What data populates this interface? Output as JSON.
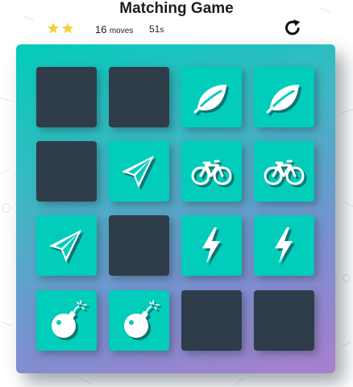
{
  "header": {
    "title": "Matching Game"
  },
  "score": {
    "stars_filled": 2,
    "star_icon": "star-icon",
    "star_color": "#f4d03f",
    "moves_count": "16",
    "moves_label": "moves",
    "timer_value": "51",
    "timer_unit": "s",
    "restart_icon": "restart-icon"
  },
  "deck": {
    "open_color": "#02ccba",
    "closed_color": "#2e3d49",
    "cards": [
      {
        "state": "closed",
        "icon": null
      },
      {
        "state": "closed",
        "icon": null
      },
      {
        "state": "open",
        "icon": "leaf-icon"
      },
      {
        "state": "open",
        "icon": "leaf-icon"
      },
      {
        "state": "closed",
        "icon": null
      },
      {
        "state": "open",
        "icon": "paper-plane-icon"
      },
      {
        "state": "open",
        "icon": "bicycle-icon"
      },
      {
        "state": "open",
        "icon": "bicycle-icon"
      },
      {
        "state": "open",
        "icon": "paper-plane-icon"
      },
      {
        "state": "closed",
        "icon": null
      },
      {
        "state": "open",
        "icon": "bolt-icon"
      },
      {
        "state": "open",
        "icon": "bolt-icon"
      },
      {
        "state": "open",
        "icon": "bomb-icon"
      },
      {
        "state": "open",
        "icon": "bomb-icon"
      },
      {
        "state": "closed",
        "icon": null
      },
      {
        "state": "closed",
        "icon": null
      }
    ]
  }
}
